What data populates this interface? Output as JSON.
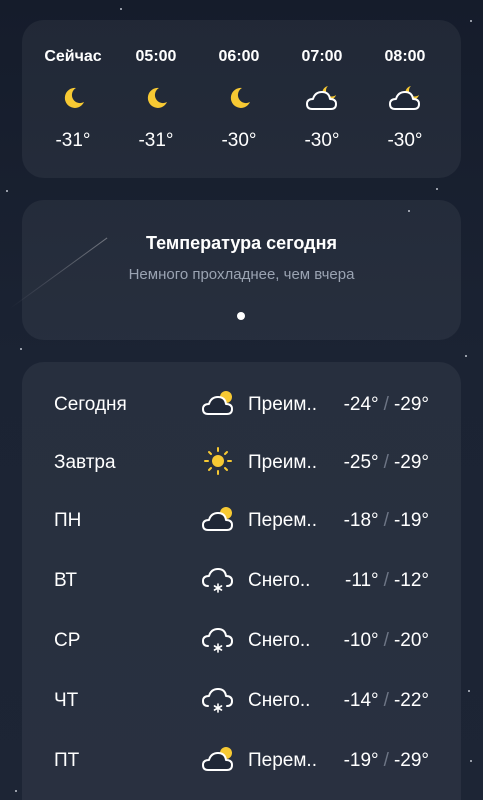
{
  "hourly": [
    {
      "time": "Сейчас",
      "icon": "moon-icon",
      "temp": "-31°"
    },
    {
      "time": "05:00",
      "icon": "moon-icon",
      "temp": "-31°"
    },
    {
      "time": "06:00",
      "icon": "moon-icon",
      "temp": "-30°"
    },
    {
      "time": "07:00",
      "icon": "cloud-moon-icon",
      "temp": "-30°"
    },
    {
      "time": "08:00",
      "icon": "cloud-moon-icon",
      "temp": "-30°"
    }
  ],
  "summary": {
    "title": "Температура сегодня",
    "subtitle": "Немного прохладнее, чем вчера"
  },
  "daily": [
    {
      "day": "Сегодня",
      "icon": "cloud-sun-icon",
      "condition": "Преим..",
      "high": "-24°",
      "low": "-29°"
    },
    {
      "day": "Завтра",
      "icon": "sun-icon",
      "condition": "Преим..",
      "high": "-25°",
      "low": "-29°"
    },
    {
      "day": "ПН",
      "icon": "cloud-sun-icon",
      "condition": "Перем..",
      "high": "-18°",
      "low": "-19°"
    },
    {
      "day": "ВТ",
      "icon": "snow-cloud-icon",
      "condition": "Снего..",
      "high": "-11°",
      "low": "-12°"
    },
    {
      "day": "СР",
      "icon": "snow-cloud-icon",
      "condition": "Снего..",
      "high": "-10°",
      "low": "-20°"
    },
    {
      "day": "ЧТ",
      "icon": "snow-cloud-icon",
      "condition": "Снего..",
      "high": "-14°",
      "low": "-22°"
    },
    {
      "day": "ПТ",
      "icon": "cloud-sun-icon",
      "condition": "Перем..",
      "high": "-19°",
      "low": "-29°"
    }
  ],
  "separator": "/",
  "colors": {
    "background": "#1b2333",
    "card": "#222a3a",
    "moon": "#f7c933",
    "sun": "#f7c933",
    "secondary_text": "#9aa3b2"
  }
}
